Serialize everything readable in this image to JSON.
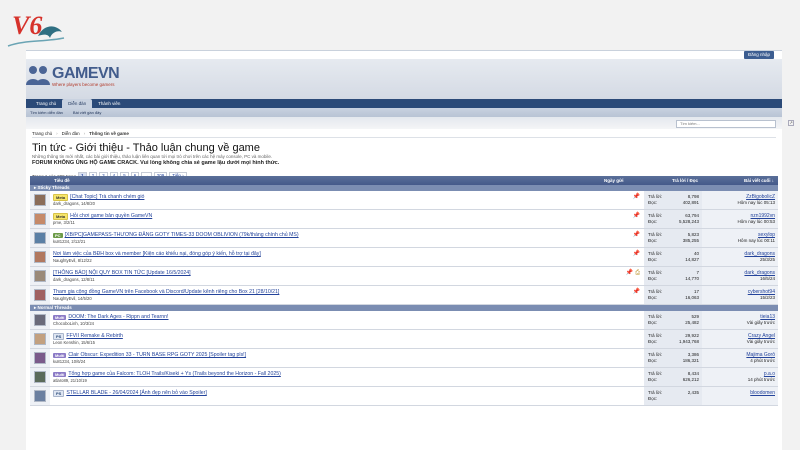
{
  "watermark": {
    "text": "V6",
    "icon": "dragon-logo"
  },
  "top": {
    "login": "Đăng nhập"
  },
  "logo": {
    "name": "GAMEVN",
    "slogan": "Where players become gamers",
    "icon": "people-logo-icon"
  },
  "nav": {
    "tabs": [
      "Trang chủ",
      "Diễn đàn",
      "Thành viên"
    ],
    "active": 1
  },
  "subnav": {
    "items": [
      "Tìm kiếm diễn đàn",
      "Bài viết gần đây"
    ]
  },
  "search": {
    "placeholder": "Tìm kiếm..."
  },
  "breadcrumb": [
    "Trang chủ",
    "Diễn đàn",
    "Thông tin về game"
  ],
  "forum": {
    "title": "Tin tức - Giới thiệu - Thảo luận chung về game",
    "description": "Những thông tin mới nhất, các bài giới thiệu, thảo luận liên quan tới mọi trò chơi trên các hệ máy console, PC và mobile.",
    "notice": "FORUM KHÔNG ỦNG HỘ GAME CRACK. Vui lòng không chia sẻ game lậu dưới mọi hình thức."
  },
  "pager": {
    "label": "Trang 1 của 209 trang",
    "pages": [
      "1",
      "2",
      "3",
      "4",
      "5",
      "6"
    ],
    "ellipsis": "→",
    "last": "209",
    "next": "Tiếp ›"
  },
  "table": {
    "headers": {
      "title": "Tiêu đề",
      "date": "Ngày gửi",
      "replies": "Trả lời",
      "views": "Đọc",
      "last": "Bài viết cuối ↓"
    },
    "groups": {
      "sticky": "▸ Sticky Threads",
      "normal": "▸ Normal Threads"
    },
    "reply_label": "Trả lời:",
    "view_label": "Đọc:",
    "sticky": [
      {
        "prefix": "Meta",
        "prefix_type": "meta",
        "title": "[Chat Topic] Trà chanh chém gió",
        "author": "dark_dragons",
        "date": "14/8/20",
        "replies": "8,798",
        "views": "402,891",
        "last_user": "ZzBigobolicZ",
        "last_time": "Hôm nay lúc 05:13",
        "icons": [
          "pin"
        ]
      },
      {
        "prefix": "Meta",
        "prefix_type": "meta",
        "title": "Hỏi chơi game bản quyền GameVN",
        "author": "pme",
        "date": "3/2/11",
        "replies": "63,794",
        "views": "5,528,243",
        "last_user": "nzn1992vn",
        "last_time": "Hôm nay lúc 00:53",
        "icons": [
          "pin"
        ]
      },
      {
        "prefix": "PC",
        "prefix_type": "pc",
        "title": "[XB/PC]GAMEPASS-THƯƠNG ĐĂNG GOTY TIMES-33 DOOM OBLIVION (79k/tháng chính chủ MS)",
        "author": "ku81234",
        "date": "2/12/21",
        "replies": "5,823",
        "views": "385,255",
        "last_user": "sexylop",
        "last_time": "Hôm nay lúc 00:11",
        "icons": [
          "pin"
        ]
      },
      {
        "prefix": "",
        "prefix_type": "",
        "title": "Nơi làm việc của BĐH box và member [Kiện cáo khiếu nại, đóng góp ý kiến, hỗ trợ tại đây]",
        "author": "NaughtyEvil",
        "date": "8/12/22",
        "replies": "40",
        "views": "14,827",
        "last_user": "dark_dragons",
        "last_time": "25/3/25",
        "icons": [
          "pin"
        ]
      },
      {
        "prefix": "",
        "prefix_type": "",
        "title": "[THÔNG BÁO] NỘI QUY BOX TIN TỨC [Update 16/5/2024]",
        "author": "dark_dragons",
        "date": "12/8/11",
        "replies": "7",
        "views": "14,770",
        "last_user": "dark_dragons",
        "last_time": "16/5/24",
        "icons": [
          "pin",
          "attachment"
        ]
      },
      {
        "prefix": "",
        "prefix_type": "",
        "title": "Tham gia cộng đồng GameVN trên Facebook và Discord/Update kênh riêng cho Box 21 [28/10/21]",
        "author": "NaughtyEvil",
        "date": "14/5/20",
        "replies": "17",
        "views": "16,063",
        "last_user": "cybershot94",
        "last_time": "15/2/23",
        "icons": [
          "pin"
        ]
      }
    ],
    "normal": [
      {
        "prefix": "Multi",
        "prefix_type": "multi",
        "title": "DOOM: The Dark Ages - Rippn and Tearnn!",
        "author": "ChocoboLinh",
        "date": "10/3/24",
        "replies": "529",
        "views": "25,482",
        "last_user": "tieia13",
        "last_time": "Vài giây trước",
        "icons": []
      },
      {
        "prefix": "PS",
        "prefix_type": "ps",
        "title": "FFVII Remake & Rebirth",
        "author": "Leon Kenshin",
        "date": "15/6/15",
        "replies": "29,922",
        "views": "1,943,768",
        "last_user": "Crazy Angel",
        "last_time": "Vài giây trước",
        "icons": []
      },
      {
        "prefix": "Multi",
        "prefix_type": "multi",
        "title": "Clair Obscur: Expedition 33 - TURN BASE RPG GOTY 2025 [Spoiler tag pls!]",
        "author": "ku81234",
        "date": "10/6/24",
        "replies": "3,386",
        "views": "186,321",
        "last_user": "Majima Gorō",
        "last_time": "4 phút trước",
        "icons": []
      },
      {
        "prefix": "Multi",
        "prefix_type": "multi",
        "title": "Tổng hợp game của Falcom: TLOH Trails/Kiseki + Ys (Trails beyond the Horizon - Fall 2025)",
        "author": "atlaro89",
        "date": "21/10/19",
        "replies": "8,434",
        "views": "626,212",
        "last_user": "p.a.o",
        "last_time": "14 phút trước",
        "icons": []
      },
      {
        "prefix": "PS",
        "prefix_type": "ps",
        "title": "STELLAR BLADE - 26/04/2024 [Ảnh đẹp nên bỏ vào Spoiler]",
        "author": "",
        "date": "",
        "replies": "2,435",
        "views": "",
        "last_user": "bloodomen",
        "last_time": "",
        "icons": []
      }
    ]
  }
}
